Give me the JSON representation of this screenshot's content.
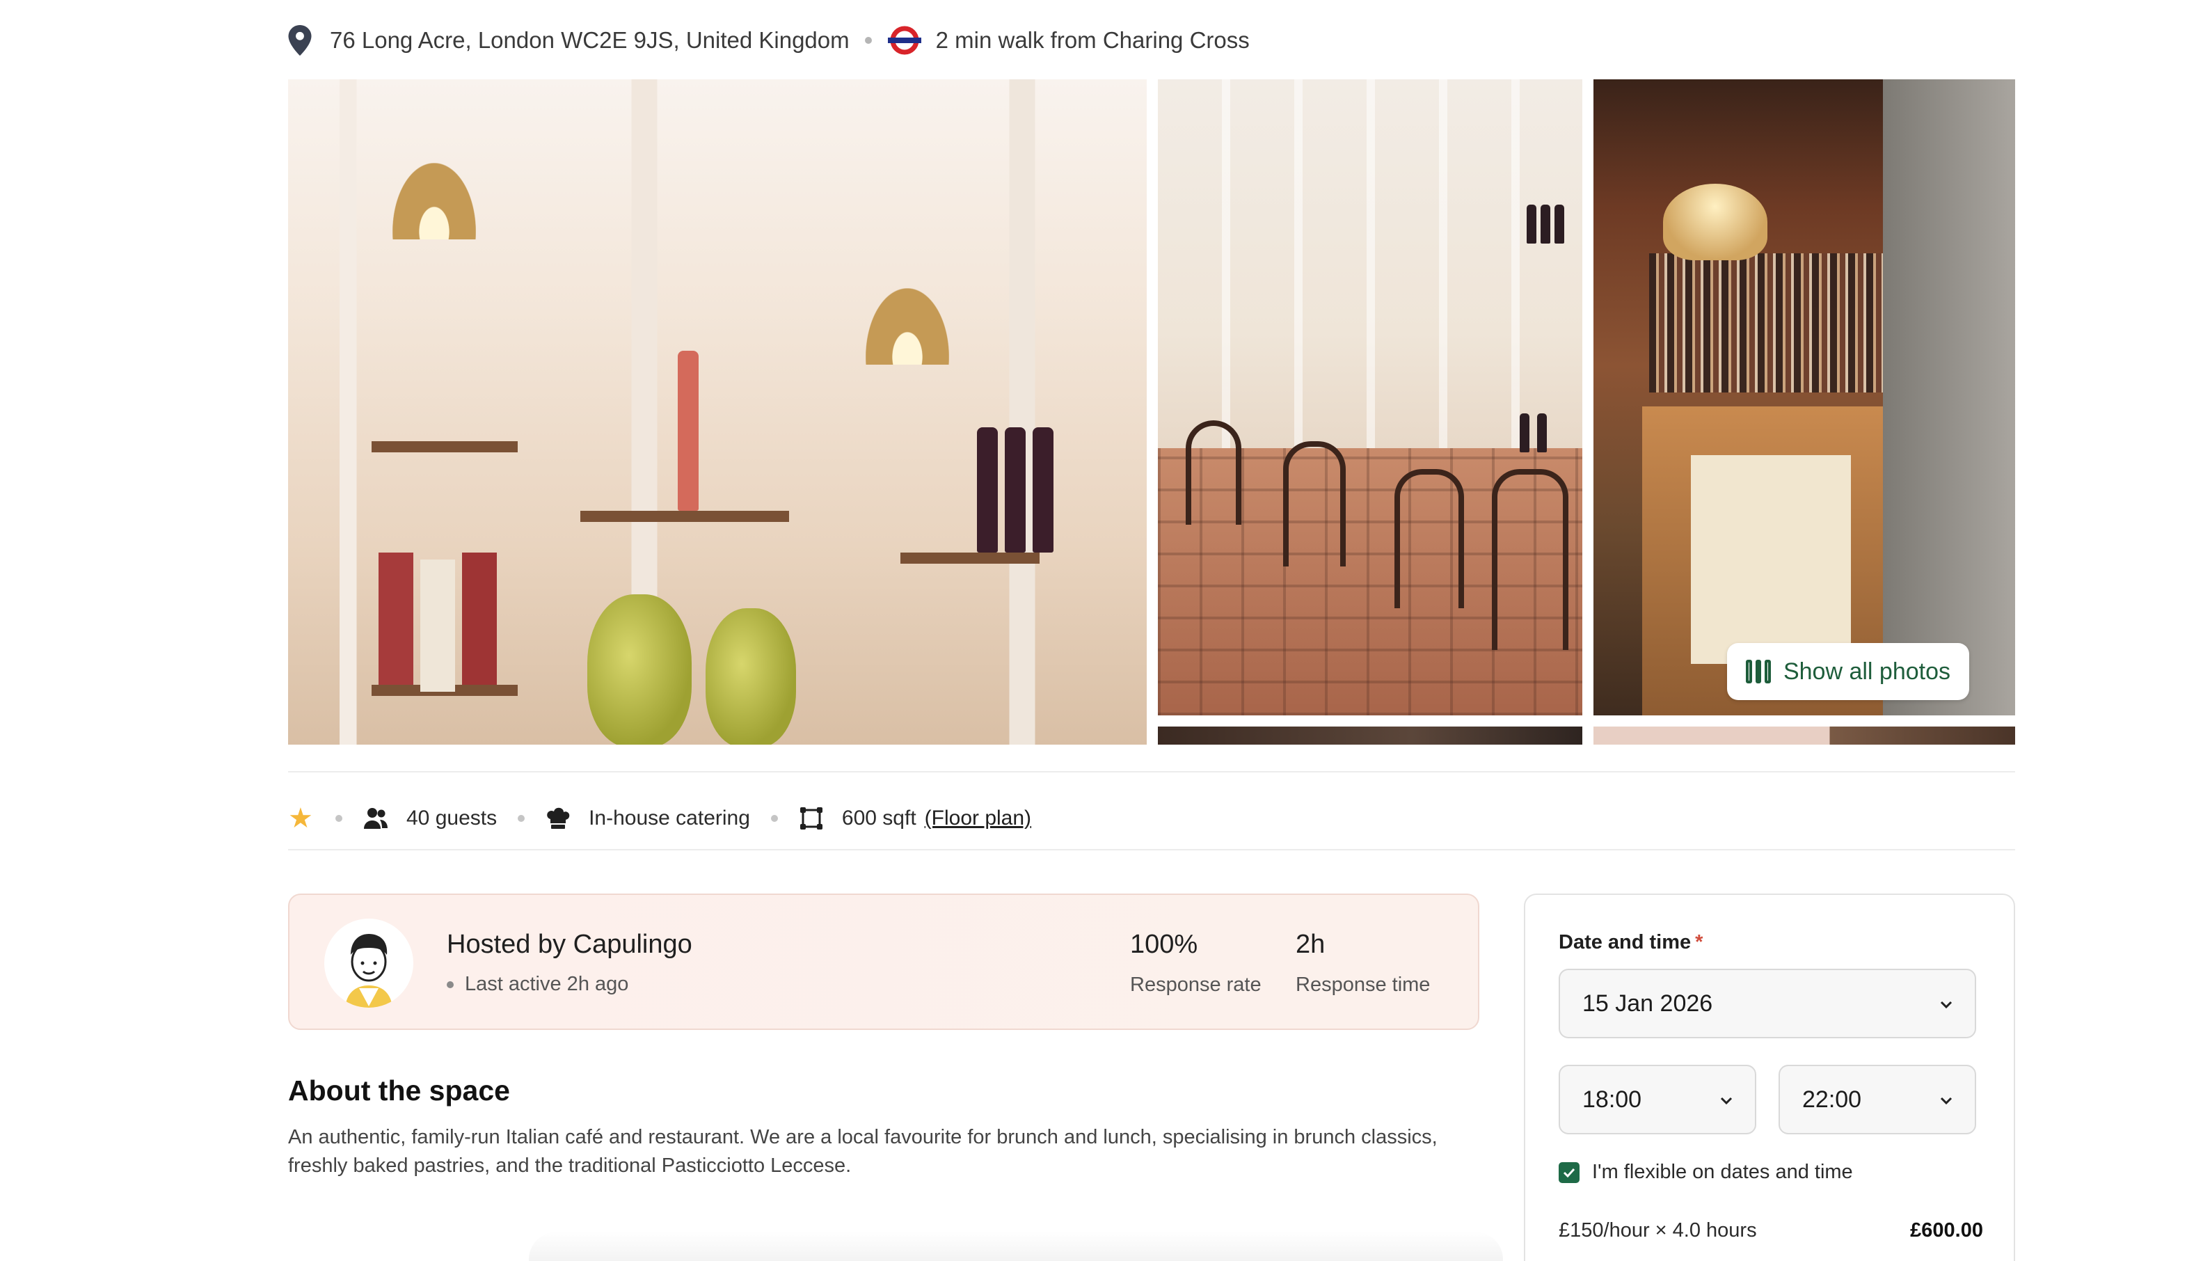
{
  "location": {
    "address": "76 Long Acre, London WC2E 9JS, United Kingdom",
    "transit": "2 min walk from Charing Cross"
  },
  "gallery": {
    "show_all_label": "Show all photos"
  },
  "features": {
    "guests": "40 guests",
    "catering": "In-house catering",
    "size": "600 sqft",
    "floor_plan": "(Floor plan)"
  },
  "host": {
    "name": "Hosted by Capulingo",
    "last_active": "Last active 2h ago",
    "response_rate_value": "100%",
    "response_rate_label": "Response rate",
    "response_time_value": "2h",
    "response_time_label": "Response time"
  },
  "about": {
    "title": "About the space",
    "text": "An authentic, family-run Italian café and restaurant. We are a local favourite for brunch and lunch, specialising in brunch classics, freshly baked pastries, and the traditional Pasticciotto Leccese."
  },
  "booking": {
    "label": "Date and time",
    "required_mark": "*",
    "date": "15 Jan 2026",
    "start_time": "18:00",
    "end_time": "22:00",
    "flexible_label": "I'm flexible on dates and time",
    "flexible_checked": true,
    "rate_line": "£150/hour × 4.0 hours",
    "rate_total": "£600.00"
  },
  "colors": {
    "accent_green": "#1e5d3b",
    "star": "#f5b73a",
    "required": "#d04c3c",
    "host_card_bg": "#fdf0ec"
  }
}
